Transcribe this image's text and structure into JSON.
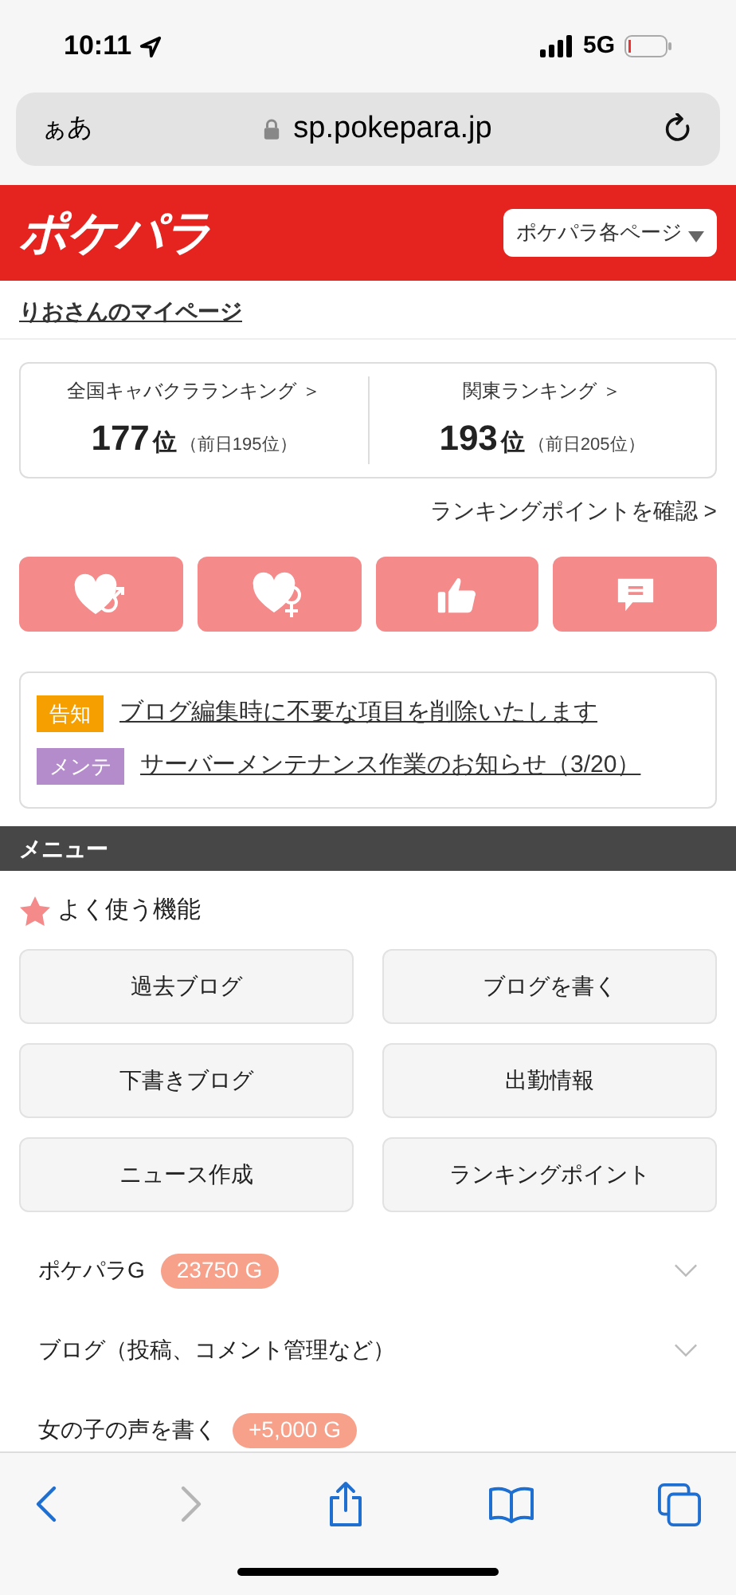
{
  "status_bar": {
    "time": "10:11",
    "network": "5G"
  },
  "browser": {
    "text_size_button": "ぁあ",
    "url": "sp.pokepara.jp"
  },
  "header": {
    "logo": "ポケパラ",
    "page_menu": "ポケパラ各ページ"
  },
  "mypage_link": "りおさんのマイページ",
  "rankings": [
    {
      "label": "全国キャバクラランキング ＞",
      "rank": "177",
      "unit": "位",
      "previous": "（前日195位）"
    },
    {
      "label": "関東ランキング ＞",
      "rank": "193",
      "unit": "位",
      "previous": "（前日205位）"
    }
  ],
  "ranking_points_link": "ランキングポイントを確認 >",
  "notices": [
    {
      "tag": "告知",
      "color": "#f5a000",
      "text": "ブログ編集時に不要な項目を削除いたします"
    },
    {
      "tag": "メンテ",
      "color": "#b48ccc",
      "text": "サーバーメンテナンス作業のお知らせ（3/20）"
    }
  ],
  "menu": {
    "title": "メニュー",
    "favorites_title": "よく使う機能",
    "favorites": [
      "過去ブログ",
      "ブログを書く",
      "下書きブログ",
      "出勤情報",
      "ニュース作成",
      "ランキングポイント"
    ],
    "sections": [
      {
        "label": "ポケパラG",
        "badge": "23750 G",
        "chevron": true
      },
      {
        "label": "ブログ（投稿、コメント管理など）",
        "chevron": true
      },
      {
        "label": "女の子の声を書く",
        "badge": "+5,000 G",
        "chevron": false
      }
    ]
  },
  "toolbar": {
    "back": {
      "disabled": false
    },
    "forward": {
      "disabled": true
    }
  }
}
